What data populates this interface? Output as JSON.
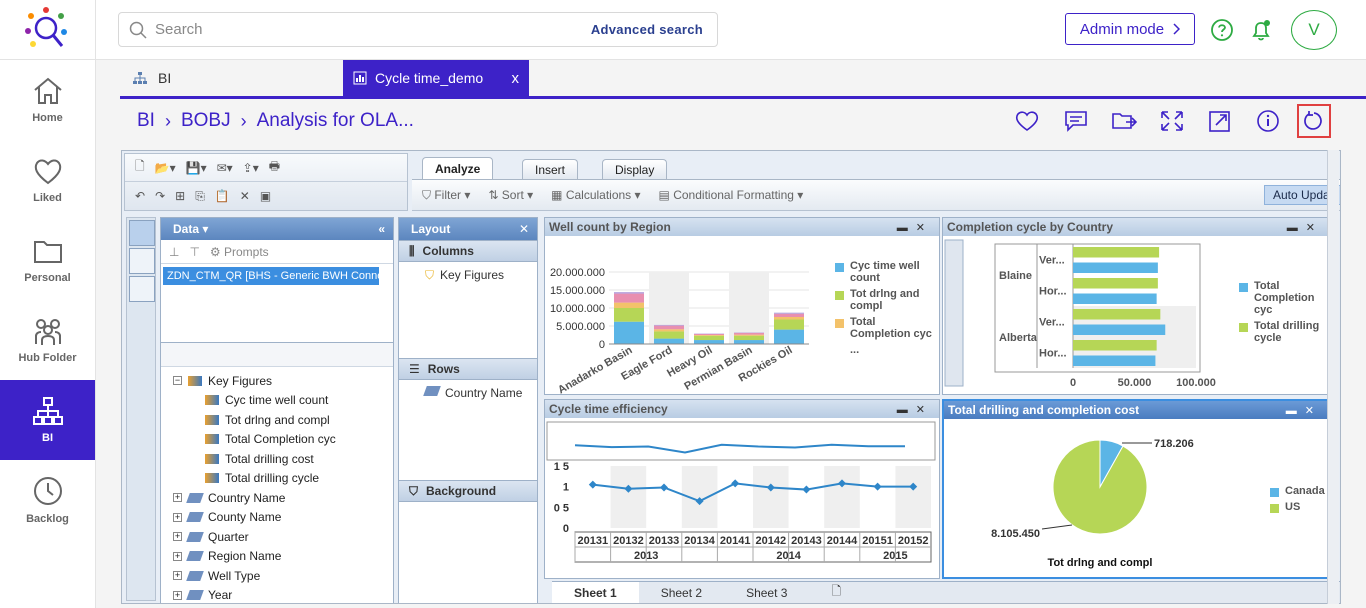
{
  "sidebar": {
    "items": [
      {
        "label": "Home",
        "icon": "home-icon"
      },
      {
        "label": "Liked",
        "icon": "heart-icon"
      },
      {
        "label": "Personal",
        "icon": "folder-icon"
      },
      {
        "label": "Hub Folder",
        "icon": "people-icon"
      },
      {
        "label": "BI",
        "icon": "hierarchy-icon",
        "active": true
      },
      {
        "label": "Backlog",
        "icon": "clock-icon"
      }
    ]
  },
  "topbar": {
    "search_placeholder": "Search",
    "advanced_search": "Advanced search",
    "admin_mode": "Admin mode",
    "avatar_initial": "V"
  },
  "tabs": {
    "bi": "BI",
    "cycle": "Cycle time_demo",
    "close": "x"
  },
  "breadcrumb": {
    "items": [
      "BI",
      "BOBJ",
      "Analysis for OLA..."
    ]
  },
  "bo": {
    "ribbon_tabs": [
      "Analyze",
      "Insert",
      "Display"
    ],
    "ribbon_tools": [
      "Filter",
      "Sort",
      "Calculations",
      "Conditional Formatting"
    ],
    "auto_update": "Auto Updat",
    "data_panel": {
      "title": "Data",
      "prompts": "Prompts",
      "connection": "ZDN_CTM_QR [BHS - Generic BWH Connec",
      "key_figures_label": "Key Figures",
      "key_figures": [
        "Cyc time well count",
        "Tot drlng and compl",
        "Total Completion cyc",
        "Total drilling cost",
        "Total drilling cycle"
      ],
      "dimensions": [
        "Country Name",
        "County Name",
        "Quarter",
        "Region Name",
        "Well Type",
        "Year"
      ]
    },
    "layout_panel": {
      "title": "Layout",
      "columns": "Columns",
      "columns_item": "Key Figures",
      "rows": "Rows",
      "rows_item": "Country Name",
      "background": "Background"
    },
    "sheets": [
      "Sheet 1",
      "Sheet 2",
      "Sheet 3"
    ]
  },
  "chart_data": [
    {
      "type": "bar",
      "title": "Well count by Region",
      "categories": [
        "Anadarko Basin",
        "Eagle Ford",
        "Heavy Oil",
        "Permian Basin",
        "Rockies Oil"
      ],
      "ylim": [
        0,
        20000000
      ],
      "ytick_labels": [
        "20.000.000",
        "15.000.000",
        "10.000.000",
        "5.000.000",
        "0"
      ],
      "series": [
        {
          "name": "Cyc time well count",
          "color": "#5bb5e6",
          "values": [
            6200000,
            1500000,
            1100000,
            1100000,
            4000000
          ]
        },
        {
          "name": "Tot drlng and compl",
          "color": "#b6d656",
          "values": [
            3800000,
            2000000,
            1200000,
            1200000,
            2800000
          ]
        },
        {
          "name": "Total Completion cyc",
          "color": "#f3c26a",
          "values": [
            1500000,
            600000,
            200000,
            300000,
            700000
          ]
        },
        {
          "name": "",
          "color": "#e88fb0",
          "values": [
            2500000,
            1000000,
            300000,
            500000,
            900000
          ]
        },
        {
          "name": "",
          "color": "#b39ddb",
          "values": [
            400000,
            200000,
            100000,
            100000,
            300000
          ]
        }
      ],
      "legend": [
        "Cyc time well count",
        "Tot drlng and compl",
        "Total Completion cyc",
        "..."
      ]
    },
    {
      "type": "bar",
      "title": "Completion cycle by Country",
      "groups": [
        {
          "name": "Blaine",
          "rows": [
            "Ver...",
            "Hor..."
          ]
        },
        {
          "name": "Alberta",
          "rows": [
            "Ver...",
            "Hor..."
          ]
        }
      ],
      "xlim": [
        0,
        100000
      ],
      "xtick_labels": [
        "0",
        "50.000",
        "100.000"
      ],
      "series": [
        {
          "name": "Total Completion cyc",
          "color": "#5bb5e6",
          "values": [
            69000,
            68000,
            75000,
            67000
          ]
        },
        {
          "name": "Total drilling cycle",
          "color": "#b6d656",
          "values": [
            70000,
            69000,
            71000,
            68000
          ]
        }
      ]
    },
    {
      "type": "line",
      "title": "Cycle time efficiency",
      "x": [
        "20131",
        "20132",
        "20133",
        "20134",
        "20141",
        "20142",
        "20143",
        "20144",
        "20151",
        "20152"
      ],
      "years": [
        "2013",
        "2014",
        "2015"
      ],
      "ytick_labels": [
        "1 5",
        "1",
        "0 5",
        "0"
      ],
      "ylim": [
        0,
        1.5
      ],
      "values": [
        1.05,
        0.95,
        0.98,
        0.65,
        1.08,
        0.98,
        0.93,
        1.08,
        1.0,
        1.0
      ],
      "color": "#2e86c9"
    },
    {
      "type": "pie",
      "title": "Total drilling and completion cost",
      "xlabel": "Tot drlng and compl",
      "slices": [
        {
          "name": "Canada",
          "value": 718206,
          "label": "718.206",
          "color": "#5bb5e6"
        },
        {
          "name": "US",
          "value": 8105450,
          "label": "8.105.450",
          "color": "#b6d656"
        }
      ]
    }
  ]
}
